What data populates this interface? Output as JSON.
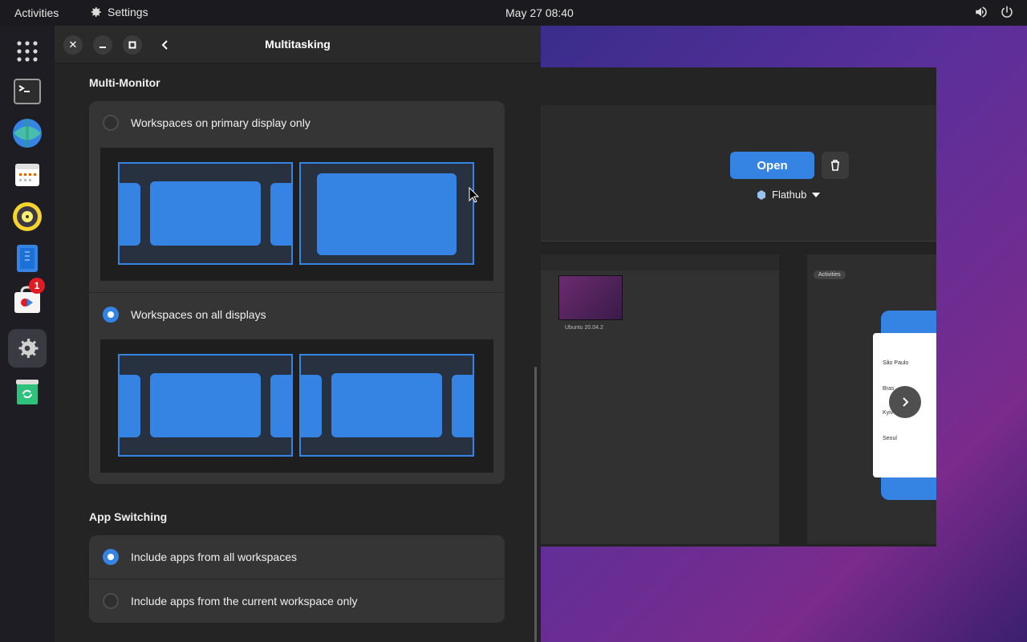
{
  "topbar": {
    "activities": "Activities",
    "app_name": "Settings",
    "clock": "May 27  08:40"
  },
  "settings": {
    "title": "Multitasking",
    "multi_monitor": {
      "heading": "Multi-Monitor",
      "options": [
        {
          "label": "Workspaces on primary display only",
          "selected": false
        },
        {
          "label": "Workspaces on all displays",
          "selected": true
        }
      ]
    },
    "app_switching": {
      "heading": "App Switching",
      "options": [
        {
          "label": "Include apps from all workspaces",
          "selected": true
        },
        {
          "label": "Include apps from the current workspace only",
          "selected": false
        }
      ]
    }
  },
  "dock": {
    "items": [
      "apps-grid-icon",
      "terminal-icon",
      "web-browser-icon",
      "calendar-icon",
      "rhythmbox-icon",
      "text-editor-icon",
      "software-icon",
      "settings-icon",
      "trash-icon"
    ],
    "software_badge": "1"
  },
  "software": {
    "open_label": "Open",
    "source_label": "Flathub",
    "screenshot_caption": "Ubuntu 20.04.2",
    "mini_chip": "Activities",
    "phone_cities": [
      "São Paulo",
      "Bras",
      "Kyiv",
      "Seoul"
    ]
  },
  "colors": {
    "accent": "#3584e4",
    "window_bg": "#242424",
    "card_bg": "#353535",
    "badge": "#e01b24"
  }
}
